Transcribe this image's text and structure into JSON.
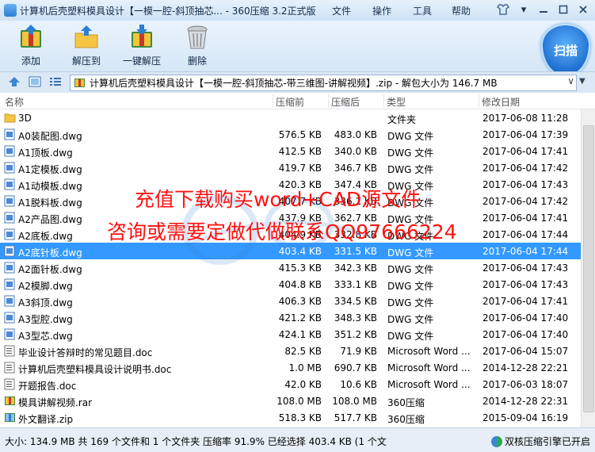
{
  "window": {
    "title": "计算机后壳塑料模具设计【一模一腔-斜顶抽芯... - 360压缩 3.2正式版",
    "menu": [
      "文件",
      "操作",
      "工具",
      "帮助"
    ]
  },
  "toolbar": {
    "buttons": [
      {
        "label": "添加",
        "icon": "add-archive-icon"
      },
      {
        "label": "解压到",
        "icon": "extract-to-icon"
      },
      {
        "label": "一键解压",
        "icon": "one-click-extract-icon"
      },
      {
        "label": "删除",
        "icon": "delete-icon"
      }
    ],
    "scan_label": "扫描"
  },
  "address": {
    "path": "计算机后壳塑料模具设计【一模一腔-斜顶抽芯-带三维图-讲解视频】.zip - 解包大小为 146.7 MB"
  },
  "columns": {
    "name": "名称",
    "size_before": "压缩前",
    "size_after": "压缩后",
    "type": "类型",
    "modified": "修改日期"
  },
  "files": [
    {
      "name": "3D",
      "before": "",
      "after": "",
      "type": "文件夹",
      "date": "2017-06-08 11:28",
      "icon": "folder-icon",
      "selected": false
    },
    {
      "name": "A0装配图.dwg",
      "before": "576.5 KB",
      "after": "483.0 KB",
      "type": "DWG 文件",
      "date": "2017-06-04 17:39",
      "icon": "dwg-file-icon",
      "selected": false
    },
    {
      "name": "A1顶板.dwg",
      "before": "412.5 KB",
      "after": "340.0 KB",
      "type": "DWG 文件",
      "date": "2017-06-04 17:41",
      "icon": "dwg-file-icon",
      "selected": false
    },
    {
      "name": "A1定模板.dwg",
      "before": "419.7 KB",
      "after": "346.7 KB",
      "type": "DWG 文件",
      "date": "2017-06-04 17:42",
      "icon": "dwg-file-icon",
      "selected": false
    },
    {
      "name": "A1动模板.dwg",
      "before": "420.3 KB",
      "after": "347.4 KB",
      "type": "DWG 文件",
      "date": "2017-06-04 17:43",
      "icon": "dwg-file-icon",
      "selected": false
    },
    {
      "name": "A1脱料板.dwg",
      "before": "407.7 KB",
      "after": "336.1 KB",
      "type": "DWG 文件",
      "date": "2017-06-04 17:42",
      "icon": "dwg-file-icon",
      "selected": false
    },
    {
      "name": "A2产品图.dwg",
      "before": "437.9 KB",
      "after": "362.7 KB",
      "type": "DWG 文件",
      "date": "2017-06-04 17:41",
      "icon": "dwg-file-icon",
      "selected": false
    },
    {
      "name": "A2底板.dwg",
      "before": "404.9 KB",
      "after": "332.8 KB",
      "type": "DWG 文件",
      "date": "2017-06-04 17:44",
      "icon": "dwg-file-icon",
      "selected": false
    },
    {
      "name": "A2底针板.dwg",
      "before": "403.4 KB",
      "after": "331.5 KB",
      "type": "DWG 文件",
      "date": "2017-06-04 17:44",
      "icon": "dwg-file-icon",
      "selected": true
    },
    {
      "name": "A2面针板.dwg",
      "before": "415.3 KB",
      "after": "342.3 KB",
      "type": "DWG 文件",
      "date": "2017-06-04 17:43",
      "icon": "dwg-file-icon",
      "selected": false
    },
    {
      "name": "A2模脚.dwg",
      "before": "404.8 KB",
      "after": "333.1 KB",
      "type": "DWG 文件",
      "date": "2017-06-04 17:43",
      "icon": "dwg-file-icon",
      "selected": false
    },
    {
      "name": "A3斜顶.dwg",
      "before": "406.3 KB",
      "after": "334.5 KB",
      "type": "DWG 文件",
      "date": "2017-06-04 17:41",
      "icon": "dwg-file-icon",
      "selected": false
    },
    {
      "name": "A3型腔.dwg",
      "before": "421.2 KB",
      "after": "348.3 KB",
      "type": "DWG 文件",
      "date": "2017-06-04 17:40",
      "icon": "dwg-file-icon",
      "selected": false
    },
    {
      "name": "A3型芯.dwg",
      "before": "424.1 KB",
      "after": "351.2 KB",
      "type": "DWG 文件",
      "date": "2017-06-04 17:40",
      "icon": "dwg-file-icon",
      "selected": false
    },
    {
      "name": "毕业设计答辩时的常见题目.doc",
      "before": "82.5 KB",
      "after": "71.9 KB",
      "type": "Microsoft Word ...",
      "date": "2017-06-04 15:07",
      "icon": "word-doc-icon",
      "selected": false
    },
    {
      "name": "计算机后壳塑料模具设计说明书.doc",
      "before": "1.0 MB",
      "after": "690.7 KB",
      "type": "Microsoft Word ...",
      "date": "2014-12-28 22:21",
      "icon": "word-doc-icon",
      "selected": false
    },
    {
      "name": "开题报告.doc",
      "before": "42.0 KB",
      "after": "10.6 KB",
      "type": "Microsoft Word ...",
      "date": "2017-06-03 18:07",
      "icon": "word-doc-icon",
      "selected": false
    },
    {
      "name": "模具讲解视频.rar",
      "before": "108.0 MB",
      "after": "108.0 MB",
      "type": "360压缩",
      "date": "2014-12-28 22:31",
      "icon": "rar-archive-icon",
      "selected": false
    },
    {
      "name": "外文翻译.zip",
      "before": "518.3 KB",
      "after": "517.7 KB",
      "type": "360压缩",
      "date": "2015-09-04 16:19",
      "icon": "zip-archive-icon",
      "selected": false
    }
  ],
  "status": {
    "text": "大小: 134.9 MB 共 169 个文件和 1 个文件夹 压缩率 91.9% 已经选择 403.4 KB (1 个文",
    "engine": "双核压缩引擎已开启"
  },
  "watermark": {
    "line1": "充值下载购买word+CAD源文件",
    "line2": "咨询或需要定做代做联系QQ97666224"
  },
  "colors": {
    "selection": "#3399ff",
    "watermark_text": "#ff1111",
    "titlebar": "#cfe2f5"
  }
}
